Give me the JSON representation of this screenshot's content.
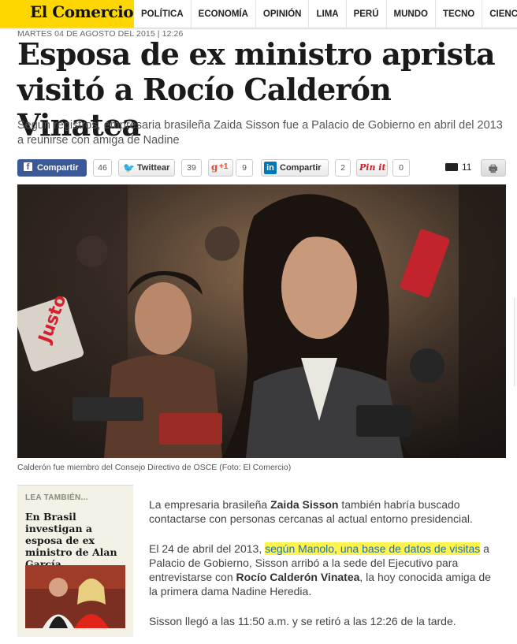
{
  "logo": "El Comercio",
  "nav": [
    "POLÍTICA",
    "ECONOMÍA",
    "OPINIÓN",
    "LIMA",
    "PERÚ",
    "MUNDO",
    "TECNO",
    "CIENCIAS"
  ],
  "dateline": "MARTES 04 DE AGOSTO DEL 2015 | 12:26",
  "headline": "Esposa de ex ministro aprista visitó a Rocío Calderón Vinatea",
  "subtitle": "Según registros, empresaria brasileña Zaida Sisson fue a Palacio de Gobierno en abril del 2013 a reunirse con amiga de Nadine",
  "share": {
    "facebook_label": "Compartir",
    "facebook_count": "46",
    "twitter_label": "Twittear",
    "twitter_count": "39",
    "gplus_label": "+1",
    "gplus_count": "9",
    "linkedin_brand": "in",
    "linkedin_label": "Compartir",
    "linkedin_count": "2",
    "pinterest_label": "Pin it",
    "pinterest_count": "0",
    "comments_count": "11"
  },
  "photo_caption": "Calderón fue miembro del Consejo Directivo de OSCE (Foto: El Comercio)",
  "sidebar": {
    "label": "LEA TAMBIÉN...",
    "title": "En Brasil investigan a esposa de ex ministro de Alan García"
  },
  "body": {
    "p1_a": "La empresaria brasileña ",
    "p1_b": "Zaida Sisson",
    "p1_c": " también habría buscado contactarse con personas cercanas al actual entorno presidencial.",
    "p2_a": "El 24 de abril del 2013, ",
    "p2_link": "según Manolo, una base de datos de visitas",
    "p2_b": " a Palacio de Gobierno, Sisson arribó a la sede del Ejecutivo para entrevistarse con ",
    "p2_c": "Rocío Calderón Vinatea",
    "p2_d": ", la hoy conocida amiga de la primera dama Nadine Heredia.",
    "p3": "Sisson llegó a las 11:50 a.m. y se retiró a las 12:26 de la tarde."
  },
  "colors": {
    "brand_yellow": "#ffd700",
    "facebook_blue": "#3b5998",
    "highlight": "#fff34d"
  }
}
